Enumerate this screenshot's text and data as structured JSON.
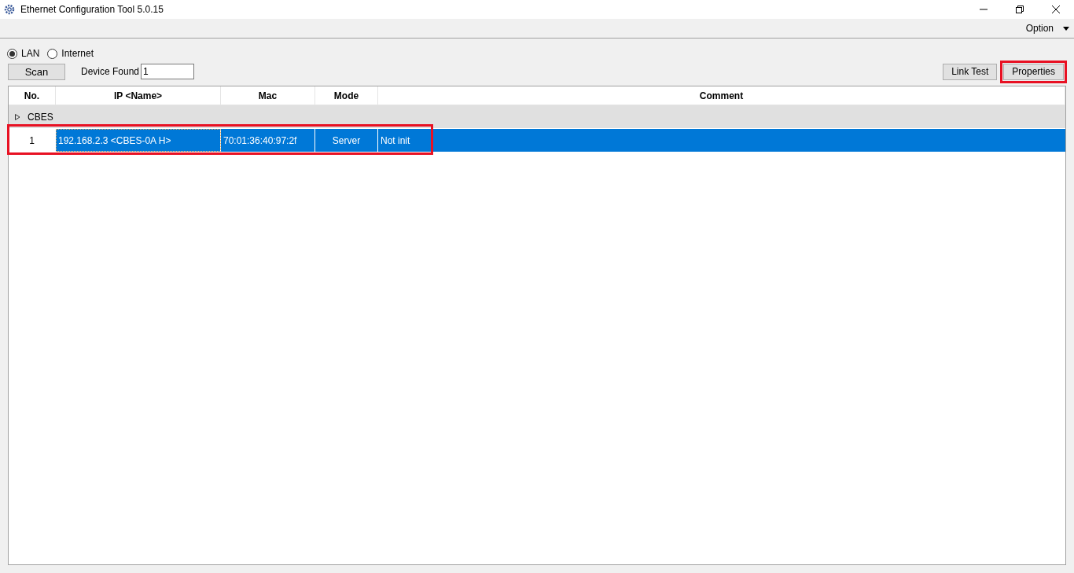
{
  "window": {
    "title": "Ethernet Configuration Tool 5.0.15"
  },
  "menu": {
    "label": "Option"
  },
  "network": [
    {
      "label": "LAN",
      "selected": true
    },
    {
      "label": "Internet",
      "selected": false
    }
  ],
  "scan_button": "Scan",
  "device_found": {
    "label": "Device Found",
    "value": "1"
  },
  "buttons": [
    {
      "label": "Link Test",
      "highlighted": false
    },
    {
      "label": "Properties",
      "highlighted": true
    }
  ],
  "table": {
    "columns": [
      "No.",
      "IP <Name>",
      "Mac",
      "Mode",
      "Comment"
    ],
    "groups": [
      {
        "name": "CBES",
        "rows": [
          {
            "cells": [
              "1",
              "192.168.2.3 <CBES-0A H>",
              "70:01:36:40:97:2f",
              "Server",
              "Not init"
            ],
            "selected": true,
            "highlighted": true
          }
        ]
      }
    ]
  }
}
